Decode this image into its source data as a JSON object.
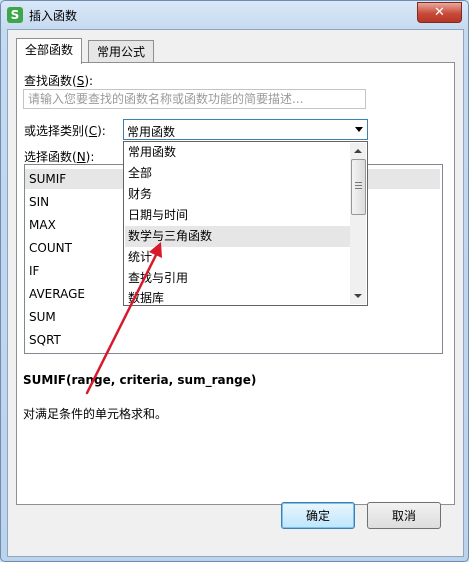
{
  "window": {
    "title": "插入函数",
    "app_icon": "S",
    "close": "✕"
  },
  "tabs": [
    {
      "label": "全部函数"
    },
    {
      "label": "常用公式"
    }
  ],
  "search": {
    "label": "查找函数(",
    "accel": "S",
    "label_end": "):",
    "placeholder": "请输入您要查找的函数名称或函数功能的简要描述..."
  },
  "category": {
    "label": "或选择类别(",
    "accel": "C",
    "label_end": "):",
    "value": "常用函数"
  },
  "function_list": {
    "label": "选择函数(",
    "accel": "N",
    "label_end": "):",
    "items": [
      "SUMIF",
      "SIN",
      "MAX",
      "COUNT",
      "IF",
      "AVERAGE",
      "SUM",
      "SQRT"
    ],
    "selected_index": 0
  },
  "dropdown": {
    "items": [
      "常用函数",
      "全部",
      "财务",
      "日期与时间",
      "数学与三角函数",
      "统计",
      "查找与引用",
      "数据库"
    ],
    "hover_index": 4
  },
  "signature": "SUMIF(range, criteria, sum_range)",
  "description": "对满足条件的单元格求和。",
  "buttons": {
    "ok": "确定",
    "cancel": "取消"
  },
  "colors": {
    "annotation_arrow": "#d7192b"
  }
}
